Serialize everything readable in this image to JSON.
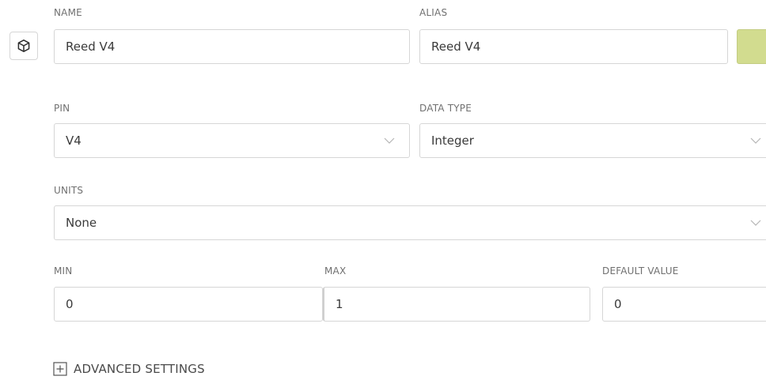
{
  "name": {
    "label": "NAME",
    "value": "Reed V4"
  },
  "alias": {
    "label": "ALIAS",
    "value": "Reed V4"
  },
  "color": {
    "value": "#d2dc8f"
  },
  "pin": {
    "label": "PIN",
    "value": "V4"
  },
  "data_type": {
    "label": "DATA TYPE",
    "value": "Integer"
  },
  "units": {
    "label": "UNITS",
    "value": "None"
  },
  "min": {
    "label": "MIN",
    "value": "0"
  },
  "max": {
    "label": "MAX",
    "value": "1"
  },
  "default_value": {
    "label": "DEFAULT VALUE",
    "value": "0"
  },
  "advanced": {
    "label": "ADVANCED SETTINGS",
    "icon": "plus-square-icon"
  },
  "model": {
    "icon": "cube-icon"
  }
}
